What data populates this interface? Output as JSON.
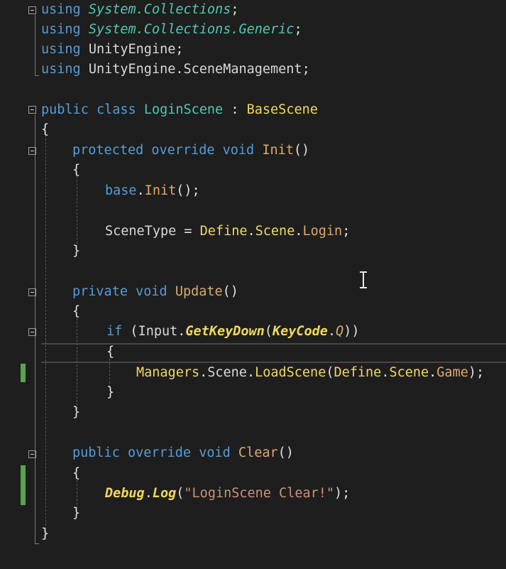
{
  "editor": {
    "lines": [
      {
        "tokens": [
          {
            "t": "using",
            "c": "kw"
          },
          {
            "t": " "
          },
          {
            "t": "System.Collections",
            "c": "type ital"
          },
          {
            "t": ";",
            "c": "punct"
          }
        ]
      },
      {
        "tokens": [
          {
            "t": "using",
            "c": "kw"
          },
          {
            "t": " "
          },
          {
            "t": "System.Collections.Generic",
            "c": "type ital"
          },
          {
            "t": ";",
            "c": "punct"
          }
        ]
      },
      {
        "tokens": [
          {
            "t": "using",
            "c": "kw"
          },
          {
            "t": " "
          },
          {
            "t": "UnityEngine",
            "c": "plain"
          },
          {
            "t": ";",
            "c": "punct"
          }
        ]
      },
      {
        "tokens": [
          {
            "t": "using",
            "c": "kw"
          },
          {
            "t": " "
          },
          {
            "t": "UnityEngine.SceneManagement",
            "c": "plain"
          },
          {
            "t": ";",
            "c": "punct"
          }
        ]
      },
      {
        "tokens": [
          {
            "t": "public",
            "c": "kw"
          },
          {
            "t": " "
          },
          {
            "t": "class",
            "c": "kw"
          },
          {
            "t": " "
          },
          {
            "t": "LoginScene",
            "c": "type"
          },
          {
            "t": " : ",
            "c": "punct"
          },
          {
            "t": "BaseScene",
            "c": "cls"
          }
        ]
      },
      {
        "tokens": [
          {
            "t": "{",
            "c": "punct"
          }
        ]
      },
      {
        "tokens": [
          {
            "t": "protected",
            "c": "kw"
          },
          {
            "t": " "
          },
          {
            "t": "override",
            "c": "kw"
          },
          {
            "t": " "
          },
          {
            "t": "void",
            "c": "kw"
          },
          {
            "t": " "
          },
          {
            "t": "Init",
            "c": "method"
          },
          {
            "t": "()",
            "c": "punct"
          }
        ]
      },
      {
        "tokens": [
          {
            "t": "{",
            "c": "punct"
          }
        ]
      },
      {
        "tokens": [
          {
            "t": "base",
            "c": "kw"
          },
          {
            "t": ".",
            "c": "punct"
          },
          {
            "t": "Init",
            "c": "method"
          },
          {
            "t": "();",
            "c": "punct"
          }
        ]
      },
      {
        "tokens": [
          {
            "t": "SceneType",
            "c": "plain"
          },
          {
            "t": " = ",
            "c": "punct"
          },
          {
            "t": "Define",
            "c": "cls"
          },
          {
            "t": ".",
            "c": "punct"
          },
          {
            "t": "Scene",
            "c": "cls"
          },
          {
            "t": ".",
            "c": "punct"
          },
          {
            "t": "Login",
            "c": "method"
          },
          {
            "t": ";",
            "c": "punct"
          }
        ]
      },
      {
        "tokens": [
          {
            "t": "}",
            "c": "punct"
          }
        ]
      },
      {
        "tokens": [
          {
            "t": "private",
            "c": "kw"
          },
          {
            "t": " "
          },
          {
            "t": "void",
            "c": "kw"
          },
          {
            "t": " "
          },
          {
            "t": "Update",
            "c": "method"
          },
          {
            "t": "()",
            "c": "punct"
          }
        ]
      },
      {
        "tokens": [
          {
            "t": "{",
            "c": "punct"
          }
        ]
      },
      {
        "tokens": [
          {
            "t": "if",
            "c": "kw"
          },
          {
            "t": " (",
            "c": "punct"
          },
          {
            "t": "Input",
            "c": "plain"
          },
          {
            "t": ".",
            "c": "punct"
          },
          {
            "t": "GetKeyDown",
            "c": "boldi"
          },
          {
            "t": "(",
            "c": "punct"
          },
          {
            "t": "KeyCode",
            "c": "boldi"
          },
          {
            "t": ".",
            "c": "punct"
          },
          {
            "t": "Q",
            "c": "method ital"
          },
          {
            "t": "))",
            "c": "punct"
          }
        ]
      },
      {
        "tokens": [
          {
            "t": "{",
            "c": "punct"
          }
        ]
      },
      {
        "tokens": [
          {
            "t": "Managers",
            "c": "cls"
          },
          {
            "t": ".",
            "c": "punct"
          },
          {
            "t": "Scene",
            "c": "plain"
          },
          {
            "t": ".",
            "c": "punct"
          },
          {
            "t": "LoadScene",
            "c": "cls"
          },
          {
            "t": "(",
            "c": "punct"
          },
          {
            "t": "Define",
            "c": "cls"
          },
          {
            "t": ".",
            "c": "punct"
          },
          {
            "t": "Scene",
            "c": "cls"
          },
          {
            "t": ".",
            "c": "punct"
          },
          {
            "t": "Game",
            "c": "method"
          },
          {
            "t": ");",
            "c": "punct"
          }
        ]
      },
      {
        "tokens": [
          {
            "t": "}",
            "c": "punct"
          }
        ]
      },
      {
        "tokens": [
          {
            "t": "}",
            "c": "punct"
          }
        ]
      },
      {
        "tokens": [
          {
            "t": "public",
            "c": "kw"
          },
          {
            "t": " "
          },
          {
            "t": "override",
            "c": "kw"
          },
          {
            "t": " "
          },
          {
            "t": "void",
            "c": "kw"
          },
          {
            "t": " "
          },
          {
            "t": "Clear",
            "c": "method"
          },
          {
            "t": "()",
            "c": "punct"
          }
        ]
      },
      {
        "tokens": [
          {
            "t": "{",
            "c": "punct"
          }
        ]
      },
      {
        "tokens": [
          {
            "t": "Debug",
            "c": "boldi"
          },
          {
            "t": ".",
            "c": "punct"
          },
          {
            "t": "Log",
            "c": "boldi"
          },
          {
            "t": "(",
            "c": "punct"
          },
          {
            "t": "\"LoginScene Clear!\"",
            "c": "str"
          },
          {
            "t": ");",
            "c": "punct"
          }
        ]
      },
      {
        "tokens": [
          {
            "t": "}",
            "c": "punct"
          }
        ]
      },
      {
        "tokens": [
          {
            "t": "}",
            "c": "punct"
          }
        ]
      }
    ]
  },
  "colors": {
    "background": "#1e1e1e",
    "keyword": "#569cd6",
    "type": "#4ec9b0",
    "class": "#f0d95c",
    "method": "#dcaa6e",
    "string": "#ce9178",
    "change_marker": "#57a64a"
  },
  "icons": [
    "fold-toggle-icon",
    "text-cursor-icon"
  ]
}
